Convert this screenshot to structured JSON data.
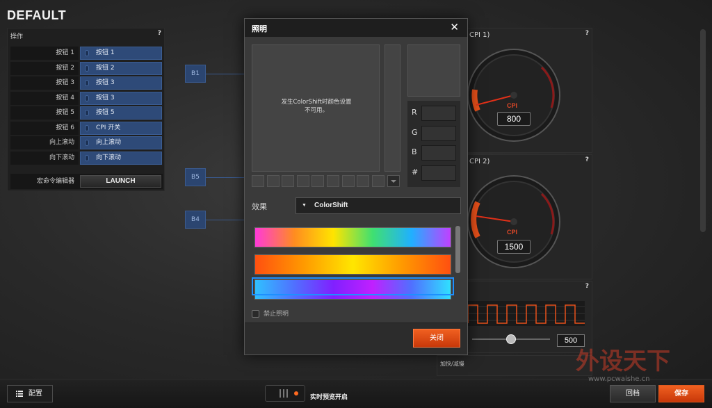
{
  "profile": {
    "title": "DEFAULT"
  },
  "actions": {
    "header": "操作",
    "help": "?",
    "rows": [
      {
        "button": "按钮 1",
        "assignment": "按钮 1"
      },
      {
        "button": "按钮 2",
        "assignment": "按钮 2"
      },
      {
        "button": "按钮 3",
        "assignment": "按钮 3"
      },
      {
        "button": "按钮 4",
        "assignment": "按钮 3"
      },
      {
        "button": "按钮 5",
        "assignment": "按钮 5"
      },
      {
        "button": "按钮 6",
        "assignment": "CPI 开关"
      },
      {
        "button": "向上滚动",
        "assignment": "向上滚动"
      },
      {
        "button": "向下滚动",
        "assignment": "向下滚动"
      }
    ],
    "macro_label": "宏命令编辑器",
    "launch_label": "LAUNCH"
  },
  "mouse_buttons": [
    "B1",
    "B5",
    "B4"
  ],
  "cpi1": {
    "title": "CPI 1)",
    "label": "CPI",
    "value": "800"
  },
  "cpi2": {
    "title": "CPI 2)",
    "label": "CPI",
    "value": "1500"
  },
  "polling": {
    "value": "500",
    "slider_fraction": 0.5
  },
  "accel": {
    "label": "加快/减慢"
  },
  "lighting_dialog": {
    "title": "照明",
    "close_icon": "✕",
    "unavailable_msg_line1": "发生ColorShift时颜色设置",
    "unavailable_msg_line2": "不可用。",
    "rgb": [
      {
        "key": "R"
      },
      {
        "key": "G"
      },
      {
        "key": "B"
      },
      {
        "key": "#"
      }
    ],
    "effect_label": "效果",
    "effect_value": "ColorShift",
    "presets": [
      {
        "gradient": [
          "#ff3ad8",
          "#ff8c20",
          "#ffe400",
          "#40e070",
          "#20b0ff",
          "#c040ff"
        ]
      },
      {
        "gradient": [
          "#ff5010",
          "#ff9a00",
          "#ffe600",
          "#ff9a00",
          "#ff5010"
        ]
      },
      {
        "gradient": [
          "#30c0ff",
          "#5070ff",
          "#8020ff",
          "#c020ff",
          "#5070ff",
          "#30e0ff"
        ]
      }
    ],
    "disable_label": "禁止照明",
    "close_button": "关闭"
  },
  "bottom": {
    "config_label": "配置",
    "preview_label": "实时预览开启",
    "revert_label": "回档",
    "save_label": "保存"
  },
  "watermark": {
    "text": "外设天下",
    "url": "www.pcwaishe.cn"
  },
  "colors": {
    "accent": "#e8501a",
    "assign_blue": "#2e4a78",
    "selection": "#1e90ff"
  }
}
